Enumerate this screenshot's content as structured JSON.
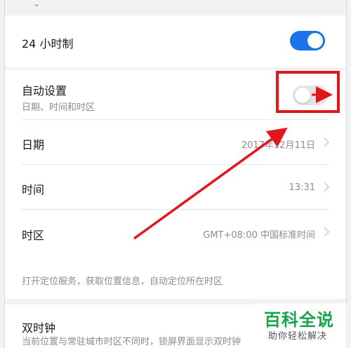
{
  "settings": {
    "clock24": {
      "label": "24 小时制",
      "enabled": true
    },
    "auto_set": {
      "label": "自动设置",
      "sublabel": "日期、时间和时区",
      "enabled": false
    },
    "date": {
      "label": "日期",
      "value": "2017年12月11日"
    },
    "time": {
      "label": "时间",
      "value": "13:31"
    },
    "timezone": {
      "label": "时区",
      "value": "GMT+08:00 中国标准时间"
    },
    "location_hint": "打开定位服务，获取位置信息，自动定位所在时区",
    "dual_clock": {
      "label": "双时钟",
      "sublabel": "当前位置与常驻城市时区不同时，锁屏界面显示双时钟"
    }
  },
  "annotation": {
    "color": "#e0161a"
  },
  "colors": {
    "accent": "#1a73e8"
  },
  "watermark": {
    "main": "百科全说",
    "sub": "助你轻松解决"
  }
}
